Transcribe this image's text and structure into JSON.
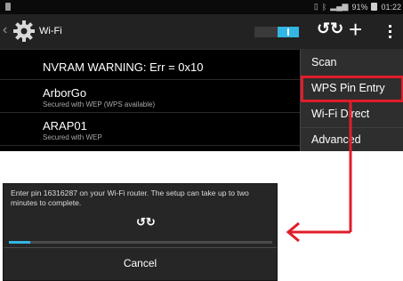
{
  "status_bar": {
    "battery_text": "91%",
    "time": "01:22",
    "icons": [
      "sim-icon",
      "no-sim-icon",
      "bluetooth-icon",
      "signal-icon",
      "battery-icon"
    ]
  },
  "action_bar": {
    "title": "Wi-Fi",
    "icons": [
      "settings-gear-icon",
      "wps-push-icon",
      "add-network-icon",
      "overflow-menu-icon"
    ],
    "wifi_toggle_on": true,
    "accent_color": "#33b5e5"
  },
  "networks": {
    "warning": "NVRAM WARNING: Err = 0x10",
    "items": [
      {
        "ssid": "ArborGo",
        "security": "Secured with WEP (WPS available)"
      },
      {
        "ssid": "ARAP01",
        "security": "Secured with WEP"
      }
    ]
  },
  "overflow_menu": {
    "items": [
      {
        "label": "Scan"
      },
      {
        "label": "WPS Pin Entry"
      },
      {
        "label": "Wi-Fi Direct"
      },
      {
        "label": "Advanced"
      }
    ],
    "highlight_color": "#e11d2a"
  },
  "wps_dialog": {
    "message": "Enter pin 16316287 on your Wi-Fi router. The setup can take up to two minutes to complete.",
    "progress_percent": 8,
    "cancel_label": "Cancel"
  }
}
